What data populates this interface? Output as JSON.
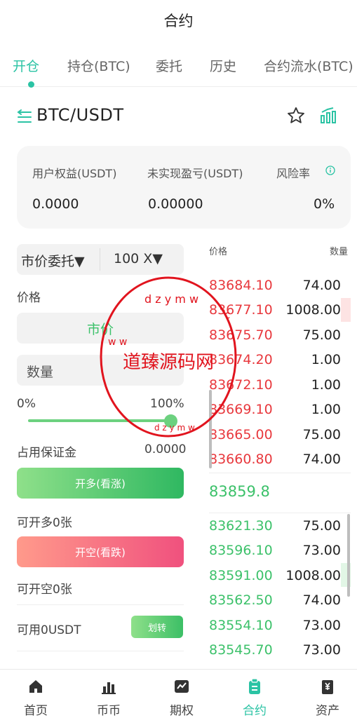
{
  "header": {
    "title": "合约"
  },
  "tabs": [
    {
      "label": "开仓",
      "active": true
    },
    {
      "label": "持仓(BTC)",
      "active": false
    },
    {
      "label": "委托",
      "active": false
    },
    {
      "label": "历史",
      "active": false
    },
    {
      "label": "合约流水(BTC)",
      "active": false
    }
  ],
  "pair": {
    "name": "BTC/USDT",
    "icons": [
      "menu-swap-icon",
      "star-icon",
      "chart-icon"
    ]
  },
  "equity": [
    {
      "label": "用户权益(USDT)",
      "value": "0.0000"
    },
    {
      "label": "未实现盈亏(USDT)",
      "value": "0.00000"
    },
    {
      "label": "风险率",
      "value": "0%"
    }
  ],
  "order_form": {
    "order_type": "市价委托▼",
    "leverage": "100 X▼",
    "price_label": "价格",
    "price_value": "市价",
    "qty_placeholder": "数量",
    "slider_min": "0%",
    "slider_max": "100%",
    "slider_level": 1.0,
    "margin_label": "占用保证金",
    "margin_value": "0.0000",
    "long_button": "开多(看涨)",
    "long_available": "可开多0张",
    "short_button": "开空(看跌)",
    "short_available": "可开空0张",
    "balance": "可用0USDT",
    "transfer_button": "划转"
  },
  "orderbook": {
    "price_header": "价格",
    "qty_header": "数量",
    "asks": [
      {
        "price": "83684.10",
        "qty": "74.00"
      },
      {
        "price": "83677.10",
        "qty": "1008.00"
      },
      {
        "price": "83675.70",
        "qty": "75.00"
      },
      {
        "price": "83674.20",
        "qty": "1.00"
      },
      {
        "price": "83672.10",
        "qty": "1.00"
      },
      {
        "price": "83669.10",
        "qty": "1.00"
      },
      {
        "price": "83665.00",
        "qty": "75.00"
      },
      {
        "price": "83660.80",
        "qty": "74.00"
      }
    ],
    "last_price": "83859.8",
    "bids": [
      {
        "price": "83621.30",
        "qty": "75.00"
      },
      {
        "price": "83596.10",
        "qty": "73.00"
      },
      {
        "price": "83591.00",
        "qty": "1008.00"
      },
      {
        "price": "83562.50",
        "qty": "74.00"
      },
      {
        "price": "83554.10",
        "qty": "73.00"
      },
      {
        "price": "83545.70",
        "qty": "73.00"
      }
    ]
  },
  "watermark": {
    "text": "道臻源码网",
    "ring_text": "dzymw.cc"
  },
  "bottom_nav": [
    {
      "label": "首页",
      "icon": "home-icon",
      "active": false
    },
    {
      "label": "币币",
      "icon": "bar-chart-icon",
      "active": false
    },
    {
      "label": "期权",
      "icon": "option-icon",
      "active": false
    },
    {
      "label": "合约",
      "icon": "contract-icon",
      "active": true
    },
    {
      "label": "资产",
      "icon": "wallet-icon",
      "active": false
    }
  ],
  "colors": {
    "accent": "#2bc3a4",
    "up": "#3cc16a",
    "down": "#e8383d",
    "watermark": "#e1141e"
  }
}
